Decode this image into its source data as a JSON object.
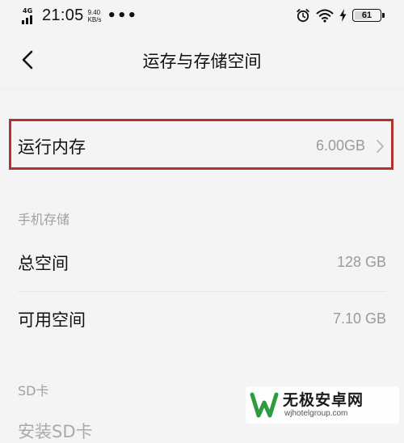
{
  "status_bar": {
    "network": "4G",
    "time": "21:05",
    "speed_value": "9.40",
    "speed_unit": "KB/s",
    "more": "•••",
    "battery": "61",
    "battery_level": 0.61
  },
  "header": {
    "title": "运存与存储空间"
  },
  "ram": {
    "label": "运行内存",
    "value": "6.00GB"
  },
  "phone_storage": {
    "section_label": "手机存储",
    "total_label": "总空间",
    "total_value": "128 GB",
    "available_label": "可用空间",
    "available_value": "7.10 GB"
  },
  "sd_card": {
    "section_label": "SD卡",
    "install_label": "安装SD卡"
  },
  "watermark": {
    "name": "无极安卓网",
    "url": "wjhotelgroup.com",
    "color": "#2e9c3e"
  },
  "colors": {
    "highlight": "#b3312e",
    "background": "#f4f4f4"
  }
}
